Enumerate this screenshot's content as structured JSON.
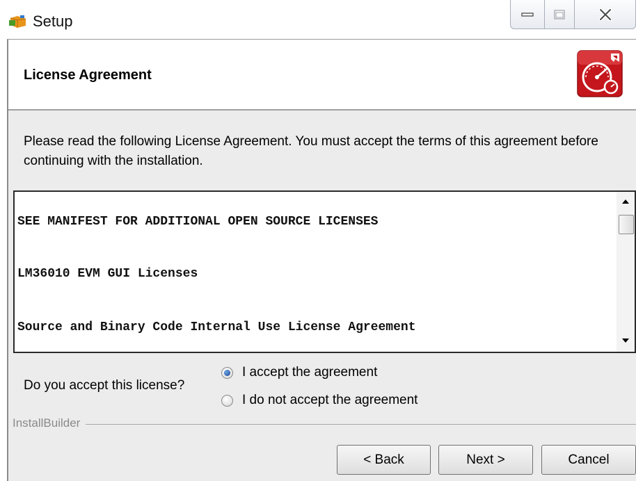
{
  "window": {
    "title": "Setup",
    "controls": [
      "minimize",
      "maximize",
      "close"
    ]
  },
  "header": {
    "title": "License Agreement",
    "logo_icon": "speedometer-logo-icon"
  },
  "instructions": "Please read the following License Agreement. You must accept the terms of this agreement before continuing with the installation.",
  "license_text": {
    "lines": [
      "SEE MANIFEST FOR ADDITIONAL OPEN SOURCE LICENSES",
      "LM36010 EVM GUI Licenses",
      "Source and Binary Code Internal Use License Agreement"
    ]
  },
  "acceptance": {
    "question": "Do you accept this license?",
    "options": [
      {
        "label": "I accept the agreement",
        "selected": true
      },
      {
        "label": "I do not accept the agreement",
        "selected": false
      }
    ]
  },
  "brand": "InstallBuilder",
  "buttons": {
    "back": "< Back",
    "next": "Next >",
    "cancel": "Cancel"
  },
  "colors": {
    "dialog_background": "#ececec",
    "logo_red": "#c4161c",
    "radio_selected": "#1c3f8a"
  }
}
